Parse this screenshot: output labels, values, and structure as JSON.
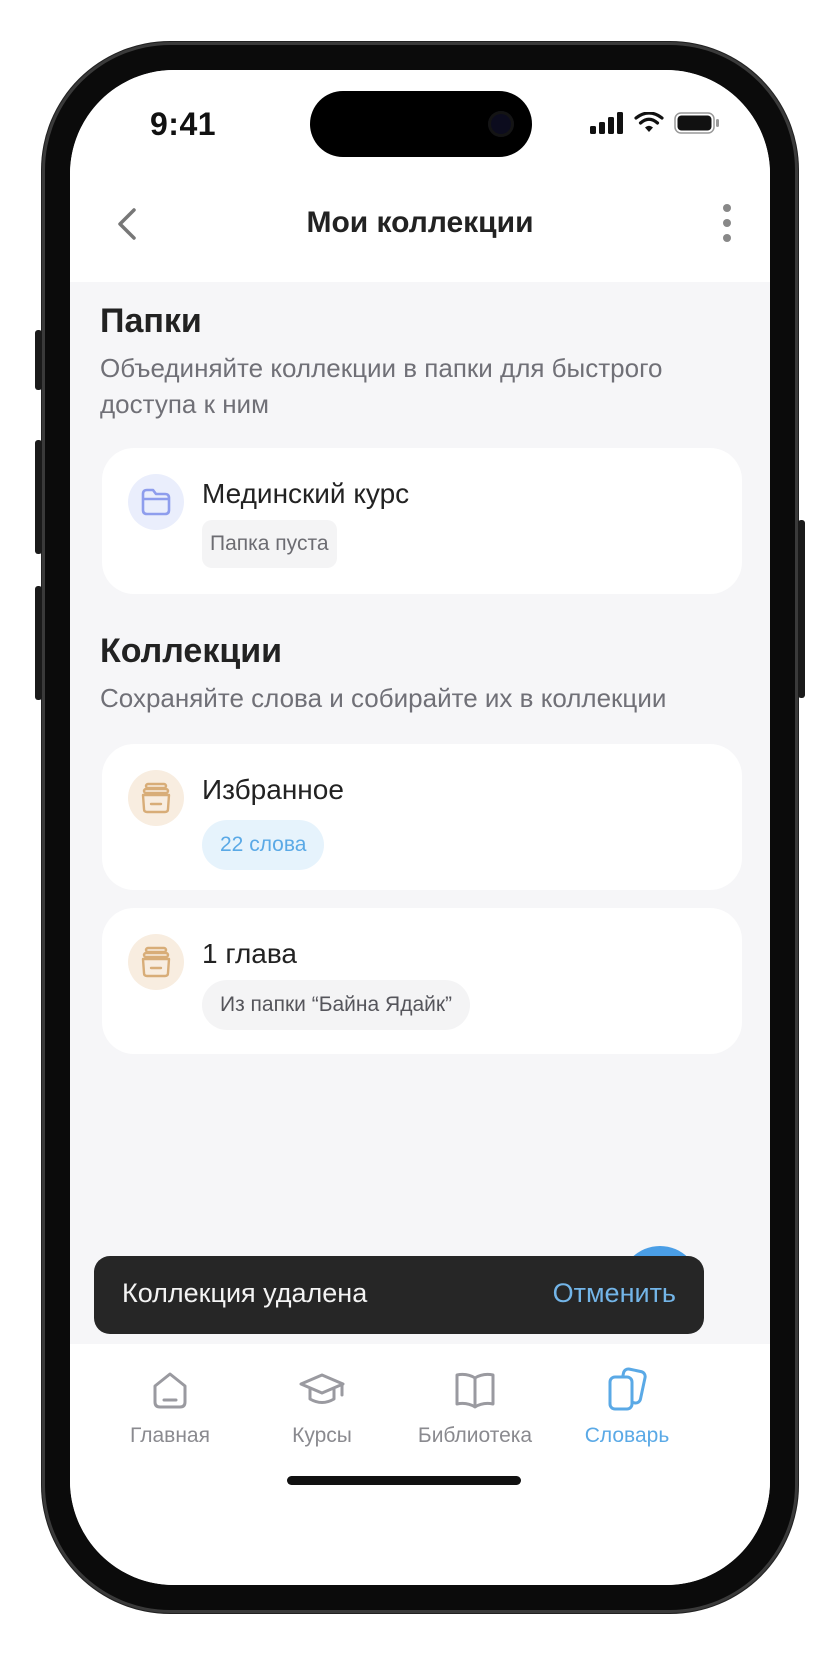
{
  "status": {
    "time": "9:41"
  },
  "nav": {
    "title": "Мои коллекции"
  },
  "folders": {
    "title": "Папки",
    "subtitle": "Объединяйте коллекции в папки для быстрого доступа к ним",
    "items": [
      {
        "name": "Мединский курс",
        "chip": "Папка пуста",
        "icon": "folder-icon"
      }
    ]
  },
  "collections": {
    "title": "Коллекции",
    "subtitle": "Сохраняйте слова и собирайте их в коллекции",
    "items": [
      {
        "name": "Избранное",
        "chip": "22 слова",
        "icon": "box-icon"
      },
      {
        "name": "1 глава",
        "chip": "Из папки “Байна Ядайк”",
        "icon": "box-icon"
      }
    ]
  },
  "toast": {
    "message": "Коллекция удалена",
    "action": "Отменить"
  },
  "tabs": [
    {
      "label": "Главная",
      "icon": "home-icon",
      "active": false
    },
    {
      "label": "Курсы",
      "icon": "graduation-cap-icon",
      "active": false
    },
    {
      "label": "Библиотека",
      "icon": "book-icon",
      "active": false
    },
    {
      "label": "Словарь",
      "icon": "cards-icon",
      "active": true
    }
  ],
  "colors": {
    "accent": "#5aa9e6",
    "folder_icon_bg": "#eaeefc",
    "box_icon_bg": "#f8ede0",
    "chip_blue_bg": "#e6f3fc",
    "chip_gray_bg": "#f4f4f5",
    "toast_bg": "#262626"
  }
}
